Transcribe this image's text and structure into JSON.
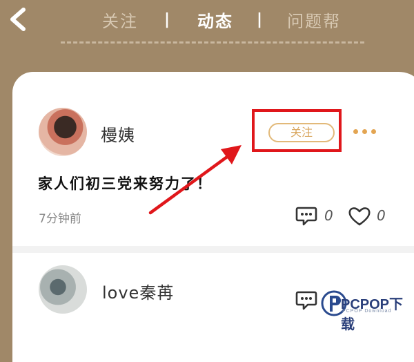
{
  "header": {
    "tabs": [
      {
        "label": "关注"
      },
      {
        "label": "动态"
      },
      {
        "label": "问题帮"
      }
    ],
    "separator": "|"
  },
  "feed": [
    {
      "username": "槾姨",
      "follow_label": "关注",
      "text": "家人们初三党来努力了！",
      "time": "7分钟前",
      "comments": "0",
      "likes": "0"
    },
    {
      "username": "love秦苒"
    }
  ],
  "watermark": {
    "brand": "PCPOP下载",
    "sub": "PCPOP Download"
  },
  "colors": {
    "header_bg": "#a08868",
    "follow_accent": "#e2b979",
    "annotation_red": "#e0171b",
    "more_dots": "#e3a552"
  }
}
